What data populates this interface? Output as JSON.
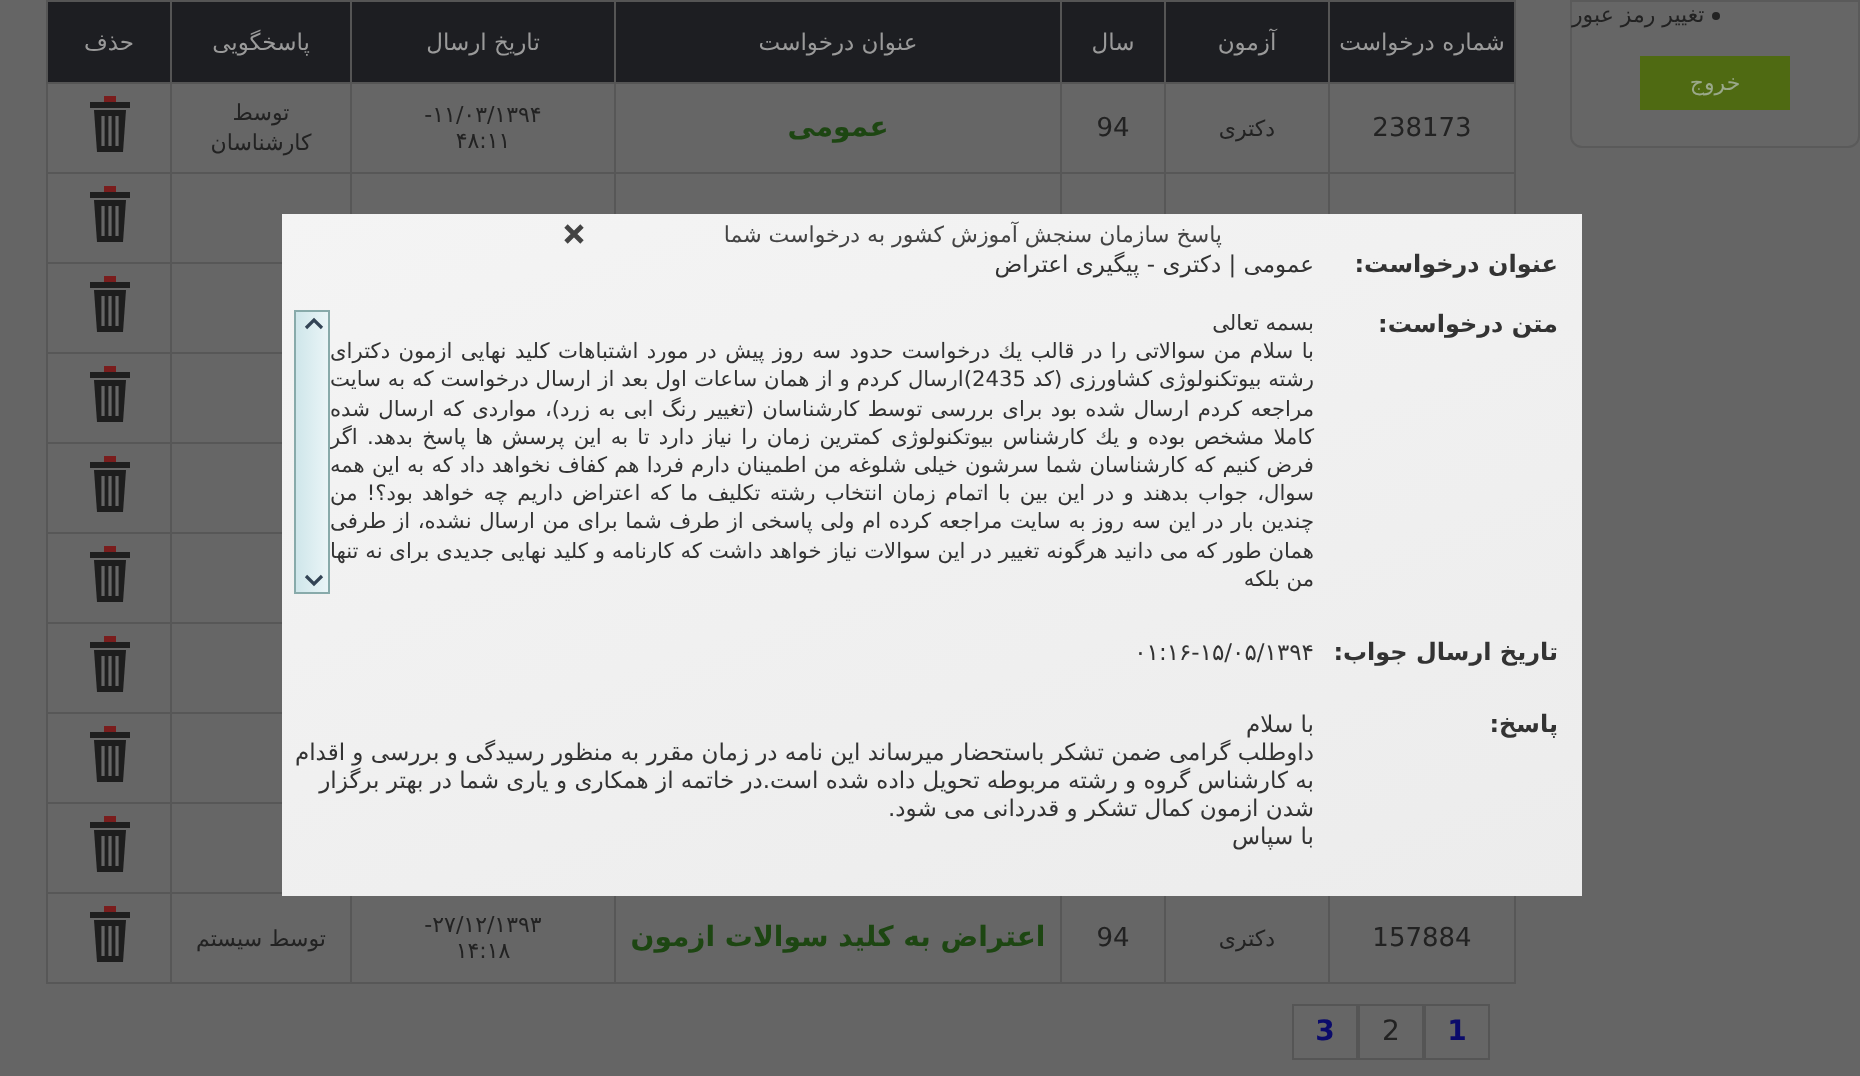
{
  "sidebar": {
    "menu_item": "تغییر رمز عبور",
    "logout_button": "خروج"
  },
  "table": {
    "columns": [
      "شماره درخواست",
      "آزمون",
      "سال",
      "عنوان درخواست",
      "تاریخ ارسال",
      "پاسخگویی",
      "حذف"
    ],
    "rows": [
      {
        "kind": "full",
        "number": "238173",
        "exam": "دکتری",
        "year": "94",
        "title": "عمومی",
        "sent": "-۱۱/۰۳/۱۳۹۴\n۴۸:۱۱",
        "responder": "توسط\nکارشناسان"
      },
      {
        "kind": "covered"
      },
      {
        "kind": "covered"
      },
      {
        "kind": "covered"
      },
      {
        "kind": "covered"
      },
      {
        "kind": "covered"
      },
      {
        "kind": "covered"
      },
      {
        "kind": "covered"
      },
      {
        "kind": "covered"
      },
      {
        "kind": "full",
        "number": "157884",
        "exam": "دکتری",
        "year": "94",
        "title": "اعتراض به کلید سوالات ازمون",
        "sent": "-۲۷/۱۲/۱۳۹۳\n۱۴:۱۸",
        "responder": "توسط سیستم"
      }
    ],
    "pagination": [
      {
        "label": "1",
        "selected": false
      },
      {
        "label": "2",
        "selected": true
      },
      {
        "label": "3",
        "selected": false
      }
    ]
  },
  "modal": {
    "title": "پاسخ سازمان سنجش آموزش کشور به درخواست شما",
    "fields": [
      {
        "kind": "text",
        "label": "عنوان درخواست:",
        "value": "عمومی | دکتری - پیگیری اعتراض"
      },
      {
        "kind": "scroll",
        "label": "متن درخواست:",
        "value": "بسمه تعالی\nبا سلام من سوالاتی را در قالب يك درخواست حدود سه روز پیش در مورد اشتباهات کلید نهایی ازمون دکترای رشته بیوتکنولوژی کشاورزی (کد 2435)ارسال کردم و از همان ساعات اول بعد از ارسال درخواست که به سایت مراجعه کردم ارسال شده بود برای بررسی توسط کارشناسان (تغییر رنگ ابی به زرد)، مواردی که ارسال شده کاملا مشخص بوده و يك کارشناس بیوتکنولوژی کمترین زمان را نیاز دارد تا به این پرسش ها پاسخ بدهد. اگر فرض کنیم که کارشناسان شما سرشون خیلی شلوغه من اطمینان دارم فردا هم کفاف نخواهد داد که به این همه سوال، جواب بدهند و در این بین با اتمام زمان انتخاب رشته تکلیف ما که اعتراض داریم چه خواهد بود؟! من چندین بار در این سه روز به سایت مراجعه کرده ام ولی پاسخی از طرف شما برای من ارسال نشده، از طرفی همان طور که می دانید هرگونه تغییر در این سوالات نیاز خواهد داشت که کارنامه و کلید نهایی جدیدی برای نه تنها من بلکه"
      },
      {
        "kind": "date",
        "label": "تاریخ ارسال جواب:",
        "value": "۰۱:۱۶-۱۵/۰۵/۱۳۹۴"
      },
      {
        "kind": "text",
        "label": "پاسخ:",
        "value": "با سلام\nداوطلب گرامی ضمن تشکر باستحضار میرساند این نامه در زمان مقرر به منظور رسیدگی و بررسی و اقدام به کارشناس گروه و رشته مربوطه تحویل داده شده است.در خاتمه از همکاری و یاری شما در بهتر برگزار شدن ازمون کمال تشکر و قدردانی می شود.\nبا سپاس"
      }
    ]
  }
}
